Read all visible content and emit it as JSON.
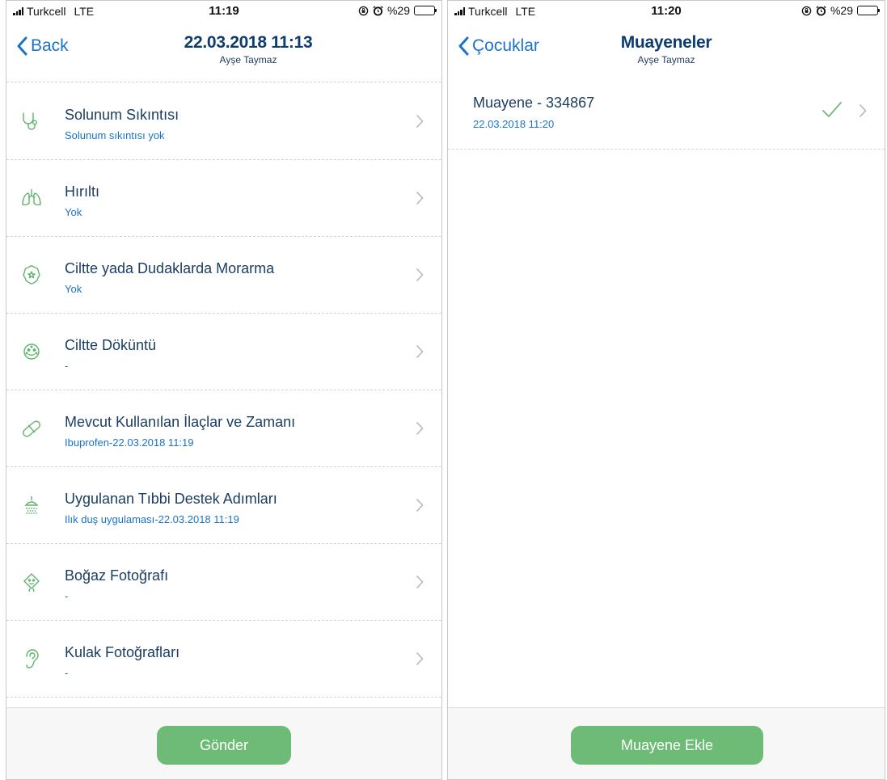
{
  "colors": {
    "accent_blue": "#1a73c8",
    "title_navy": "#0d3d6e",
    "icon_green": "#5fb46b",
    "button_green": "#6dbb77"
  },
  "left": {
    "status": {
      "carrier": "Turkcell",
      "network": "LTE",
      "time": "11:19",
      "battery": "%29"
    },
    "nav": {
      "back_label": "Back",
      "title": "22.03.2018 11:13",
      "subtitle": "Ayşe Taymaz"
    },
    "items": [
      {
        "icon": "stethoscope-icon",
        "title": "Solunum Sıkıntısı",
        "value": "Solunum sıkıntısı yok"
      },
      {
        "icon": "lungs-icon",
        "title": "Hırıltı",
        "value": "Yok"
      },
      {
        "icon": "face-star-icon",
        "title": "Ciltte yada Dudaklarda Morarma",
        "value": "Yok"
      },
      {
        "icon": "rash-face-icon",
        "title": "Ciltte Döküntü",
        "value": "-"
      },
      {
        "icon": "pill-icon",
        "title": "Mevcut Kullanılan İlaçlar ve Zamanı",
        "value": "Ibuprofen-22.03.2018 11:19"
      },
      {
        "icon": "shower-icon",
        "title": "Uygulanan Tıbbi Destek Adımları",
        "value": "Ilık duş uygulaması-22.03.2018 11:19"
      },
      {
        "icon": "baby-face-icon",
        "title": "Boğaz Fotoğrafı",
        "value": "-"
      },
      {
        "icon": "ear-icon",
        "title": "Kulak Fotoğrafları",
        "value": "-"
      }
    ],
    "button_label": "Gönder"
  },
  "right": {
    "status": {
      "carrier": "Turkcell",
      "network": "LTE",
      "time": "11:20",
      "battery": "%29"
    },
    "nav": {
      "back_label": "Çocuklar",
      "title": "Muayeneler",
      "subtitle": "Ayşe Taymaz"
    },
    "exams": [
      {
        "title": "Muayene - 334867",
        "date": "22.03.2018 11:20",
        "status_icon": "check-icon"
      }
    ],
    "button_label": "Muayene Ekle"
  }
}
